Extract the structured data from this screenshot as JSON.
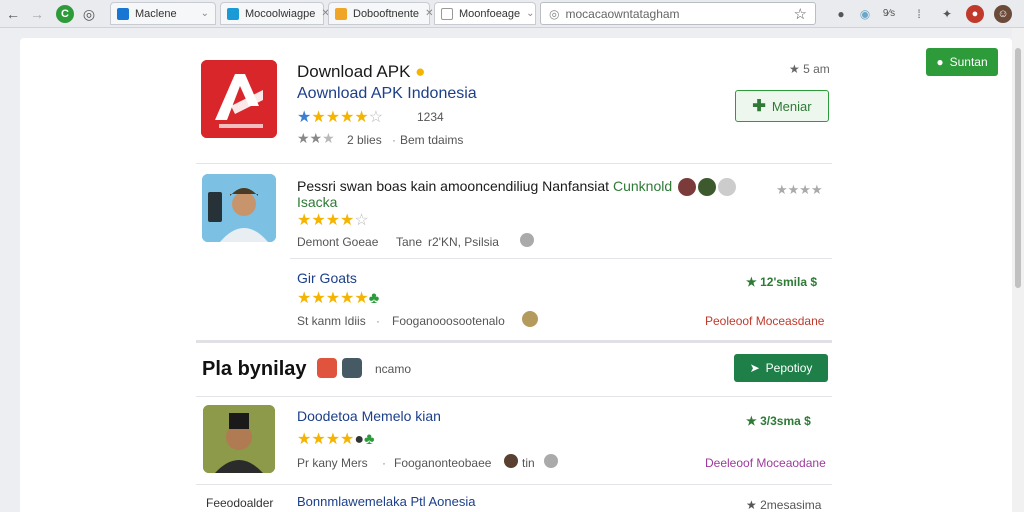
{
  "browser": {
    "tabs": [
      {
        "label": "Maclene",
        "fav_color": "#1976d2"
      },
      {
        "label": "Mocoolwiagpe",
        "fav_color": "#1a9bd6"
      },
      {
        "label": "Dobooftnente",
        "fav_color": "#f1a526"
      },
      {
        "label": "Moonfoeage",
        "fav_color": "#e0e0e0"
      }
    ],
    "address": "mocacaowntatagham"
  },
  "page": {
    "install_button": "Suntan",
    "featured": {
      "title": "Download APK",
      "subtitle": "Aownload APK Indonesia",
      "rating_count": "1234",
      "meta_left": "2 blies",
      "meta_right": "Bem tdaims",
      "corner_meta": "5 am",
      "action_button": "Meniar",
      "stars": 4.5
    },
    "items": [
      {
        "title_line1": "Pessri swan boas kain amooncendiliug Nanfansiat",
        "title_green": "Cunknold",
        "title_line2": "Isacka",
        "meta": "Demont Goeae",
        "meta2": "Tane",
        "meta3": "r2'KN, Psilsia",
        "stars": 4,
        "right_meta": "★★★★"
      },
      {
        "title": "Gir Goats",
        "meta_left": "St kanm Idiis",
        "meta_right": "Fooganooosootenalo",
        "right_top": "12'smila",
        "right_bottom": "Peoleoof Moceasdane",
        "stars": 5
      }
    ],
    "section": {
      "title": "Pla bynilay",
      "meta": "ncamo",
      "button": "Pepotioy"
    },
    "items2": [
      {
        "title": "Doodetoa Memelo kian",
        "meta_left": "Pr kany Mers",
        "meta_right": "Fooganonteobaee",
        "meta_tail": "tin",
        "right_top": "3/3sma",
        "right_bottom": "Deeleoof Moceaodane",
        "stars": 4
      },
      {
        "left": "Feeodoalder",
        "title": "Bonnmlawemelaka Ptl Aonesia",
        "right_top": "2mesasima"
      }
    ]
  }
}
